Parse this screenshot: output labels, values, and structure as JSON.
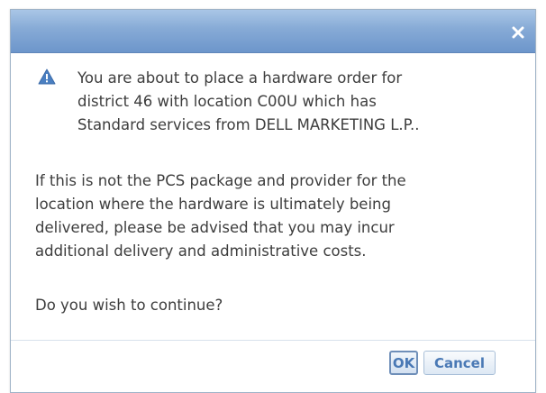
{
  "dialog": {
    "close_icon": "close-icon",
    "warning_icon": "warning-icon",
    "message_main": "You are about to place a hardware order for\ndistrict 46 with location C00U which has\nStandard services from DELL MARKETING L.P..",
    "message_note": "If this is not the PCS package and provider for the\nlocation where the hardware is ultimately being\ndelivered, please be advised that you may incur\nadditional delivery and administrative costs.",
    "question": "Do you wish to continue?",
    "ok_label": "OK",
    "cancel_label": "Cancel"
  },
  "colors": {
    "titlebar": "#86aad6",
    "warning": "#4a7fc1",
    "button_text": "#4a79b5",
    "text": "#3d3d3d"
  }
}
